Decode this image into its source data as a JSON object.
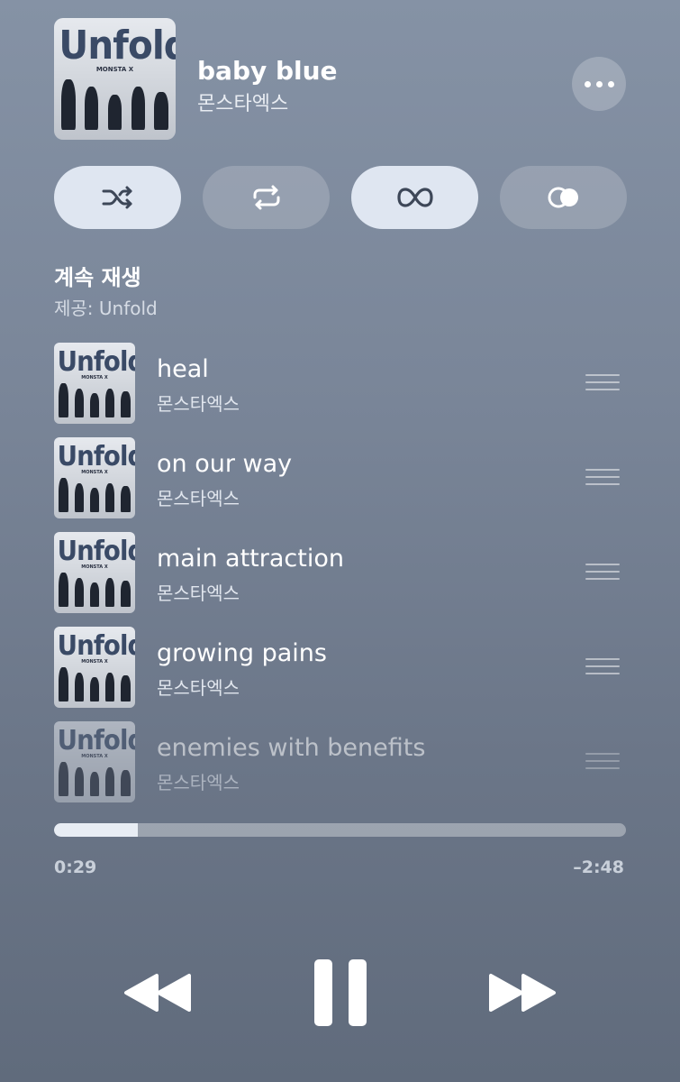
{
  "now_playing": {
    "title": "baby blue",
    "artist": "몬스타엑스",
    "album_art_text": "Unfold",
    "album_art_subtext": "MONSTA X"
  },
  "controls": [
    {
      "name": "shuffle-icon",
      "active": true
    },
    {
      "name": "repeat-icon",
      "active": false
    },
    {
      "name": "infinity-autoplay-icon",
      "active": true
    },
    {
      "name": "crossfade-icon",
      "active": false
    }
  ],
  "section": {
    "title": "계속 재생",
    "subtitle_prefix": "제공: ",
    "subtitle_source": "Unfold"
  },
  "queue": [
    {
      "title": "heal",
      "artist": "몬스타엑스"
    },
    {
      "title": "on our way",
      "artist": "몬스타엑스"
    },
    {
      "title": "main attraction",
      "artist": "몬스타엑스"
    },
    {
      "title": "growing pains",
      "artist": "몬스타엑스"
    },
    {
      "title": "enemies with benefits",
      "artist": "몬스타엑스"
    }
  ],
  "playback": {
    "elapsed": "0:29",
    "remaining": "–2:48",
    "progress_fraction": 0.146
  },
  "colors": {
    "button_active_bg": "#dfe6f1",
    "icon_dark": "#3d4758"
  }
}
